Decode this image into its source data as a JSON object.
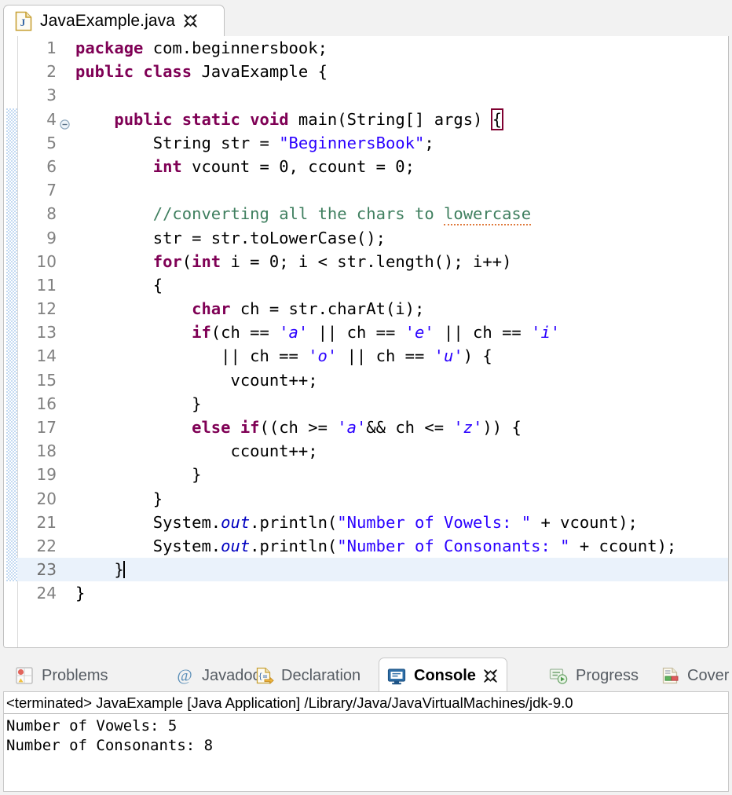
{
  "editor_tab": {
    "label": "JavaExample.java",
    "icon": "java-file-icon",
    "close_icon": "close-icon"
  },
  "code": {
    "lines": [
      {
        "n": "1",
        "fold": false
      },
      {
        "n": "2",
        "fold": false
      },
      {
        "n": "3",
        "fold": false
      },
      {
        "n": "4",
        "fold": true
      },
      {
        "n": "5",
        "fold": false
      },
      {
        "n": "6",
        "fold": false
      },
      {
        "n": "7",
        "fold": false
      },
      {
        "n": "8",
        "fold": false
      },
      {
        "n": "9",
        "fold": false
      },
      {
        "n": "10",
        "fold": false
      },
      {
        "n": "11",
        "fold": false
      },
      {
        "n": "12",
        "fold": false
      },
      {
        "n": "13",
        "fold": false
      },
      {
        "n": "14",
        "fold": false
      },
      {
        "n": "15",
        "fold": false
      },
      {
        "n": "16",
        "fold": false
      },
      {
        "n": "17",
        "fold": false
      },
      {
        "n": "18",
        "fold": false
      },
      {
        "n": "19",
        "fold": false
      },
      {
        "n": "20",
        "fold": false
      },
      {
        "n": "21",
        "fold": false
      },
      {
        "n": "22",
        "fold": false
      },
      {
        "n": "23",
        "fold": false,
        "current": true
      },
      {
        "n": "24",
        "fold": false
      }
    ],
    "text": [
      "package com.beginnersbook;",
      "public class JavaExample {",
      "",
      "    public static void main(String[] args) {",
      "        String str = \"BeginnersBook\";",
      "        int vcount = 0, ccount = 0;",
      "",
      "        //converting all the chars to lowercase",
      "        str = str.toLowerCase();",
      "        for(int i = 0; i < str.length(); i++)",
      "        {",
      "            char ch = str.charAt(i);",
      "            if(ch == 'a' || ch == 'e' || ch == 'i'",
      "               || ch == 'o' || ch == 'u') {",
      "                vcount++;",
      "            }",
      "            else if((ch >= 'a'&& ch <= 'z')) {",
      "                ccount++;",
      "            }",
      "        }",
      "        System.out.println(\"Number of Vowels: \" + vcount);",
      "        System.out.println(\"Number of Consonants: \" + ccount);",
      "    }",
      "}"
    ],
    "marker_range_start_line": 4,
    "marker_range_end_line": 23,
    "colors": {
      "keyword": "#7f0055",
      "string": "#2a00ff",
      "comment": "#3f7f5f",
      "static_field": "#0000c0",
      "spellcheck_underline": "#e07a3c",
      "bracket_match_outline": "#7f0030",
      "current_line_highlight": "#eaf2fb",
      "marker_range": "#c4daf2"
    }
  },
  "bottom_tabs": [
    {
      "label": "Problems",
      "icon": "problems-icon",
      "active": false
    },
    {
      "label": "Javadoc",
      "icon": "javadoc-at-icon",
      "active": false
    },
    {
      "label": "Declaration",
      "icon": "declaration-icon",
      "active": false
    },
    {
      "label": "Console",
      "icon": "console-icon",
      "active": true,
      "close_icon": "close-icon"
    },
    {
      "label": "Progress",
      "icon": "progress-icon",
      "active": false
    },
    {
      "label": "Cover",
      "icon": "coverage-icon",
      "active": false
    }
  ],
  "console": {
    "header": "<terminated> JavaExample [Java Application] /Library/Java/JavaVirtualMachines/jdk-9.0",
    "output": [
      "Number of Vowels: 5",
      "Number of Consonants: 8"
    ]
  }
}
